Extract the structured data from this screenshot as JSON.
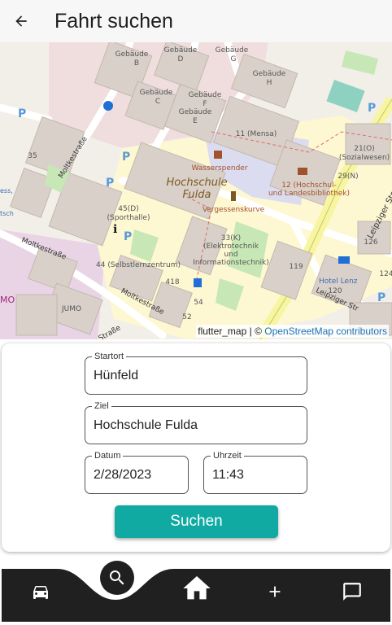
{
  "appbar": {
    "title": "Fahrt suchen",
    "back_icon": "arrow-back-icon"
  },
  "map": {
    "attribution_prefix": "flutter_map | © ",
    "attribution_link": "OpenStreetMap contributors",
    "labels": {
      "gebaeude_b": "Gebäude\nB",
      "gebaeude_d": "Gebäude\nD",
      "gebaeude_g": "Gebäude\nG",
      "gebaeude_c": "Gebäude\nC",
      "gebaeude_f": "Gebäude\nF",
      "gebaeude_e": "Gebäude\nE",
      "gebaeude_h": "Gebäude\nH",
      "mensa": "11 (Mensa)",
      "sozialwesen": "21(O)\n(Sozialwesen)",
      "wasserspender": "Wasserspender",
      "n29": "29(N)",
      "hochschule": "Hochschule\nFulda",
      "bibliothek": "12 (Hochschul-\nund Landesbibliothek)",
      "leipziger_strasse": "Leipziger Straße",
      "vergessenskurve": "Vergessenskurve",
      "sporthalle": "45(D)\n(Sporthalle)",
      "elektrotechnik": "33(K)\n(Elektrotechnik\nund\nInformationstechnik)",
      "moltkestrasse_top": "Moltkestraße",
      "moltkestrasse_left": "Moltkestraße",
      "moltkestrasse_bottom": "Moltkestraße",
      "selbstlernzentrum": "44 (Selbstlernzentrum)",
      "n418": "418",
      "n119": "119",
      "n54": "54",
      "n52": "52",
      "n35": "35",
      "n126": "126",
      "n120": "120",
      "n124": "124",
      "hotel_lenz": "Hotel Lenz",
      "jumo_left": "MO",
      "jumo": "JUMO",
      "leipziger_str_short": "Leipziger Str",
      "strasse_bottom": "Straße",
      "ess": "ess,",
      "tsch": "tsch"
    }
  },
  "form": {
    "start": {
      "label": "Startort",
      "value": "Hünfeld"
    },
    "destination": {
      "label": "Ziel",
      "value": "Hochschule Fulda"
    },
    "date": {
      "label": "Datum",
      "value": "2/28/2023"
    },
    "time": {
      "label": "Uhrzeit",
      "value": "11:43"
    },
    "search_button": "Suchen"
  },
  "bottom_nav": {
    "items": [
      {
        "icon": "car-icon"
      },
      {
        "icon": "search-icon"
      },
      {
        "icon": "home-icon"
      },
      {
        "icon": "add-icon"
      },
      {
        "icon": "chat-icon"
      }
    ]
  },
  "colors": {
    "accent": "#10aaa3",
    "nav_background": "#202020",
    "appbar_background": "#f7f7f7"
  }
}
